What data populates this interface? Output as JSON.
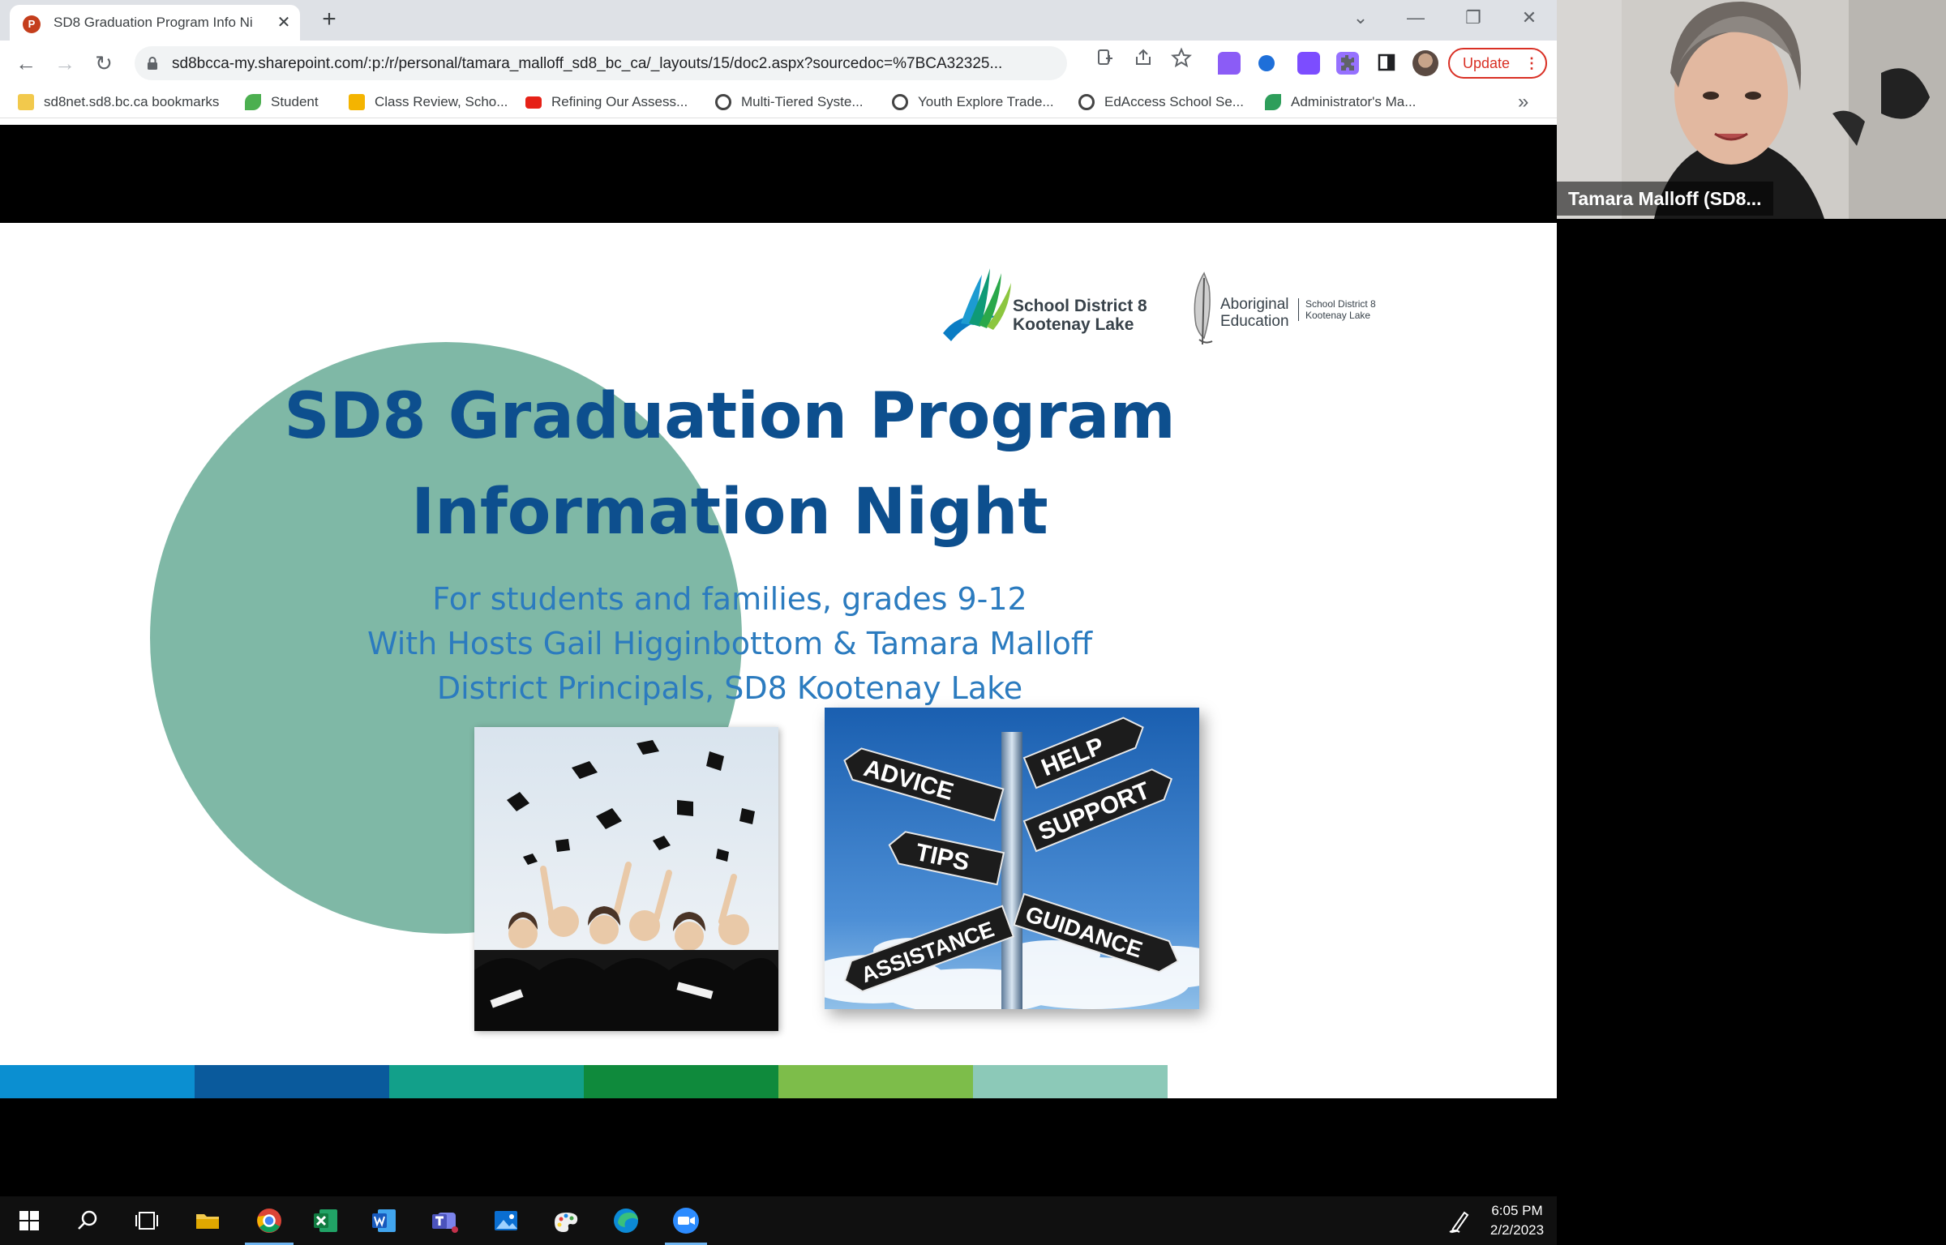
{
  "browser": {
    "tab": {
      "title": "SD8 Graduation Program Info Ni",
      "favicon_letter": "P",
      "close_glyph": "✕"
    },
    "new_tab_glyph": "+",
    "window_controls": {
      "dropdown": "⌄",
      "minimize": "—",
      "restore": "❐",
      "close": "✕"
    },
    "nav": {
      "back": "←",
      "forward": "→",
      "reload": "↻"
    },
    "url": "sd8bcca-my.sharepoint.com/:p:/r/personal/tamara_malloff_sd8_bc_ca/_layouts/15/doc2.aspx?sourcedoc=%7BCA32325...",
    "update_label": "Update",
    "update_menu": "⋮",
    "bookmarks": [
      {
        "label": "sd8net.sd8.bc.ca bookmarks",
        "icon": "folder-icon",
        "color": "#f2c94c"
      },
      {
        "label": "Student",
        "icon": "leaf-icon",
        "color": "#4caf50"
      },
      {
        "label": "Class Review, Scho...",
        "icon": "bookmark-app-icon",
        "color": "#f4b400"
      },
      {
        "label": "Refining Our Assess...",
        "icon": "youtube-icon",
        "color": "#e62117"
      },
      {
        "label": "Multi-Tiered Syste...",
        "icon": "globe-icon",
        "color": "#444444"
      },
      {
        "label": "Youth Explore Trade...",
        "icon": "globe-icon",
        "color": "#444444"
      },
      {
        "label": "EdAccess School Se...",
        "icon": "globe-icon",
        "color": "#444444"
      },
      {
        "label": "Administrator's Ma...",
        "icon": "leaf-icon",
        "color": "#2e9e5b"
      }
    ],
    "bookmarks_more": "»"
  },
  "slide": {
    "logo_sd8": {
      "line1": "School District 8",
      "line2": "Kootenay Lake"
    },
    "logo_aboriginal": {
      "line1": "Aboriginal",
      "line2": "Education",
      "sub1": "School District 8",
      "sub2": "Kootenay Lake"
    },
    "title_line1": "SD8 Graduation Program",
    "title_line2": "Information Night",
    "subtitle_line1": "For students and families, grades 9-12",
    "subtitle_line2": "With Hosts Gail Higginbottom & Tamara Malloff",
    "subtitle_line3": "District Principals, SD8 Kootenay Lake",
    "signpost": {
      "advice": "ADVICE",
      "help": "HELP",
      "support": "SUPPORT",
      "tips": "TIPS",
      "assistance": "ASSISTANCE",
      "guidance": "GUIDANCE"
    },
    "colorbar": [
      "#0b8fd1",
      "#0a5a9c",
      "#12a08a",
      "#0f8a3c",
      "#7dbd4a",
      "#8cc9b8"
    ]
  },
  "video": {
    "participant_name": "Tamara Malloff (SD8..."
  },
  "taskbar": {
    "time": "6:05 PM",
    "date": "2/2/2023"
  },
  "colors": {
    "title_blue": "#0d4f8e",
    "subtitle_blue": "#2b7bbf",
    "circle": "#7fb8a6",
    "update_red": "#d93025"
  }
}
